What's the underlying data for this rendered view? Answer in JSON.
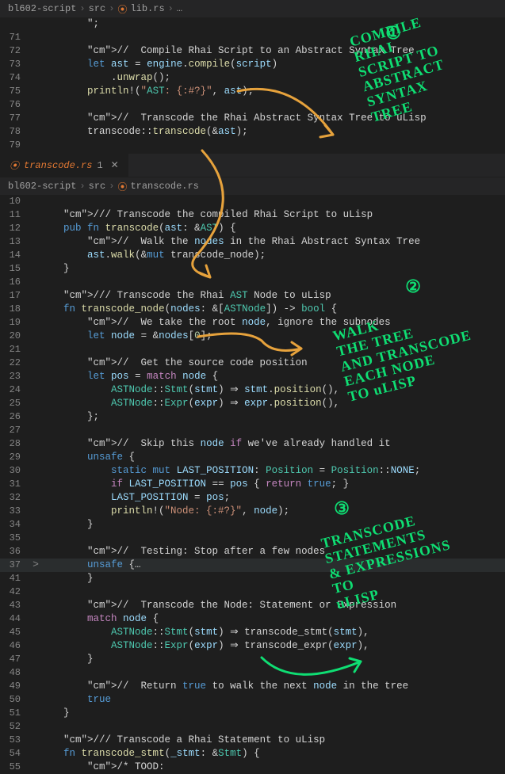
{
  "breadcrumb_top": {
    "root": "bl602-script",
    "src": "src",
    "file": "lib.rs"
  },
  "breadcrumb_bot": {
    "root": "bl602-script",
    "src": "src",
    "file": "transcode.rs"
  },
  "tab_label": "transcode.rs",
  "top_editor": [
    {
      "n": "",
      "c": "        \";"
    },
    {
      "n": "71",
      "c": ""
    },
    {
      "n": "72",
      "c": "        //  Compile Rhai Script to an Abstract Syntax Tree"
    },
    {
      "n": "73",
      "c": "        let ast = engine.compile(script)"
    },
    {
      "n": "74",
      "c": "            .unwrap();"
    },
    {
      "n": "75",
      "c": "        println!(\"AST: {:#?}\", ast);"
    },
    {
      "n": "76",
      "c": ""
    },
    {
      "n": "77",
      "c": "        //  Transcode the Rhai Abstract Syntax Tree to uLisp"
    },
    {
      "n": "78",
      "c": "        transcode::transcode(&ast);"
    },
    {
      "n": "79",
      "c": ""
    }
  ],
  "bot_editor": [
    {
      "n": "10",
      "c": ""
    },
    {
      "n": "11",
      "c": "    /// Transcode the compiled Rhai Script to uLisp"
    },
    {
      "n": "12",
      "c": "    pub fn transcode(ast: &AST) {"
    },
    {
      "n": "13",
      "c": "        //  Walk the nodes in the Rhai Abstract Syntax Tree"
    },
    {
      "n": "14",
      "c": "        ast.walk(&mut transcode_node);"
    },
    {
      "n": "15",
      "c": "    }"
    },
    {
      "n": "16",
      "c": ""
    },
    {
      "n": "17",
      "c": "    /// Transcode the Rhai AST Node to uLisp"
    },
    {
      "n": "18",
      "c": "    fn transcode_node(nodes: &[ASTNode]) -> bool {"
    },
    {
      "n": "19",
      "c": "        //  We take the root node, ignore the subnodes"
    },
    {
      "n": "20",
      "c": "        let node = &nodes[0];"
    },
    {
      "n": "21",
      "c": ""
    },
    {
      "n": "22",
      "c": "        //  Get the source code position"
    },
    {
      "n": "23",
      "c": "        let pos = match node {"
    },
    {
      "n": "24",
      "c": "            ASTNode::Stmt(stmt) => stmt.position(),"
    },
    {
      "n": "25",
      "c": "            ASTNode::Expr(expr) => expr.position(),"
    },
    {
      "n": "26",
      "c": "        };"
    },
    {
      "n": "27",
      "c": ""
    },
    {
      "n": "28",
      "c": "        //  Skip this node if we've already handled it"
    },
    {
      "n": "29",
      "c": "        unsafe {"
    },
    {
      "n": "30",
      "c": "            static mut LAST_POSITION: Position = Position::NONE;"
    },
    {
      "n": "31",
      "c": "            if LAST_POSITION == pos { return true; }"
    },
    {
      "n": "32",
      "c": "            LAST_POSITION = pos;"
    },
    {
      "n": "33",
      "c": "            println!(\"Node: {:#?}\", node);"
    },
    {
      "n": "34",
      "c": "        }"
    },
    {
      "n": "35",
      "c": ""
    },
    {
      "n": "36",
      "c": "        //  Testing: Stop after a few nodes"
    },
    {
      "n": "37",
      "c": "        unsafe {…",
      "hl": true,
      "fold": ">"
    },
    {
      "n": "41",
      "c": "        }"
    },
    {
      "n": "42",
      "c": ""
    },
    {
      "n": "43",
      "c": "        //  Transcode the Node: Statement or Expression"
    },
    {
      "n": "44",
      "c": "        match node {"
    },
    {
      "n": "45",
      "c": "            ASTNode::Stmt(stmt) => transcode_stmt(stmt),"
    },
    {
      "n": "46",
      "c": "            ASTNode::Expr(expr) => transcode_expr(expr),"
    },
    {
      "n": "47",
      "c": "        }"
    },
    {
      "n": "48",
      "c": ""
    },
    {
      "n": "49",
      "c": "        //  Return true to walk the next node in the tree"
    },
    {
      "n": "50",
      "c": "        true"
    },
    {
      "n": "51",
      "c": "    }"
    },
    {
      "n": "52",
      "c": ""
    },
    {
      "n": "53",
      "c": "    /// Transcode a Rhai Statement to uLisp"
    },
    {
      "n": "54",
      "c": "    fn transcode_stmt(_stmt: &Stmt) {"
    },
    {
      "n": "55",
      "c": "        /* TOOD:"
    }
  ],
  "annotations": {
    "a1": "COMPILE\nRHAI\nSCRIPT TO\nABSTRACT\nSYNTAX\nTREE",
    "a2": "WALK\nTHE TREE\nAND TRANSCODE\nEACH NODE\nTO uLISP",
    "a3": "TRANSCODE\nSTATEMENTS\n& EXPRESSIONS\nTO\nuLISP",
    "n1": "①",
    "n2": "②",
    "n3": "③"
  }
}
